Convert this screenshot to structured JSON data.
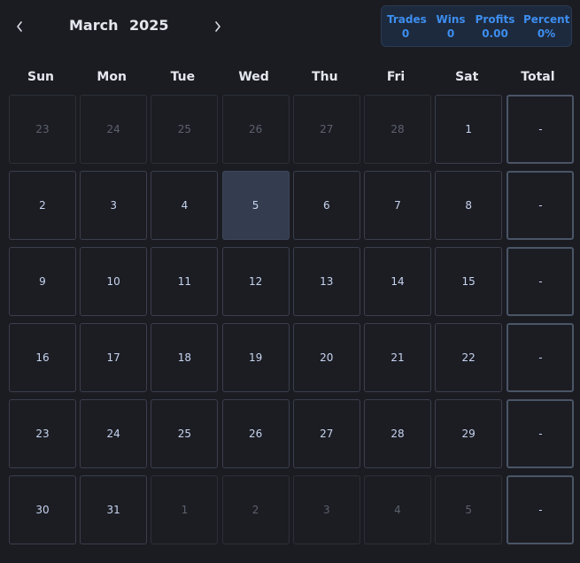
{
  "header": {
    "month": "March",
    "year": "2025",
    "prev_icon": "chevron-left-icon",
    "next_icon": "chevron-right-icon"
  },
  "stats": {
    "trades_label": "Trades",
    "trades_value": "0",
    "wins_label": "Wins",
    "wins_value": "0",
    "profits_label": "Profits",
    "profits_value": "0.00",
    "percent_label": "Percent",
    "percent_value": "0%"
  },
  "weekdays": [
    "Sun",
    "Mon",
    "Tue",
    "Wed",
    "Thu",
    "Fri",
    "Sat",
    "Total"
  ],
  "weeks": [
    {
      "days": [
        {
          "n": "23",
          "other": true
        },
        {
          "n": "24",
          "other": true
        },
        {
          "n": "25",
          "other": true
        },
        {
          "n": "26",
          "other": true
        },
        {
          "n": "27",
          "other": true
        },
        {
          "n": "28",
          "other": true
        },
        {
          "n": "1"
        }
      ],
      "total": "-"
    },
    {
      "days": [
        {
          "n": "2"
        },
        {
          "n": "3"
        },
        {
          "n": "4"
        },
        {
          "n": "5",
          "today": true
        },
        {
          "n": "6"
        },
        {
          "n": "7"
        },
        {
          "n": "8"
        }
      ],
      "total": "-"
    },
    {
      "days": [
        {
          "n": "9"
        },
        {
          "n": "10"
        },
        {
          "n": "11"
        },
        {
          "n": "12"
        },
        {
          "n": "13"
        },
        {
          "n": "14"
        },
        {
          "n": "15"
        }
      ],
      "total": "-"
    },
    {
      "days": [
        {
          "n": "16"
        },
        {
          "n": "17"
        },
        {
          "n": "18"
        },
        {
          "n": "19"
        },
        {
          "n": "20"
        },
        {
          "n": "21"
        },
        {
          "n": "22"
        }
      ],
      "total": "-"
    },
    {
      "days": [
        {
          "n": "23"
        },
        {
          "n": "24"
        },
        {
          "n": "25"
        },
        {
          "n": "26"
        },
        {
          "n": "27"
        },
        {
          "n": "28"
        },
        {
          "n": "29"
        }
      ],
      "total": "-"
    },
    {
      "days": [
        {
          "n": "30"
        },
        {
          "n": "31"
        },
        {
          "n": "1",
          "other": true
        },
        {
          "n": "2",
          "other": true
        },
        {
          "n": "3",
          "other": true
        },
        {
          "n": "4",
          "other": true
        },
        {
          "n": "5",
          "other": true
        }
      ],
      "total": "-"
    }
  ]
}
